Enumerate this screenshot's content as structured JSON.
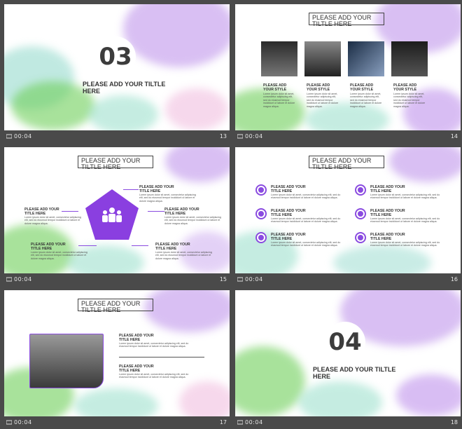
{
  "slides": [
    {
      "number": "13",
      "time": "00:04",
      "big": "03",
      "title": "PLEASE ADD YOUR TILTLE HERE"
    },
    {
      "number": "14",
      "time": "00:04",
      "title": "PLEASE ADD YOUR TILTLE HERE",
      "item_label": "PLEASE ADD YOUR STYLE",
      "item_text": "Lorem ipsum dolor sit amet, consectetur adipiscing elit, sed do eiusmod tempor incididunt ut labore et dolore magna aliqua."
    },
    {
      "number": "15",
      "time": "00:04",
      "title": "PLEASE ADD YOUR TILTLE HERE",
      "label": "PLEASE ADD YOUR TITLE HERE",
      "text": "Lorem ipsum dolor sit amet, consectetur adipiscing elit, sed do eiusmod tempor incididunt ut labore et dolore magna aliqua."
    },
    {
      "number": "16",
      "time": "00:04",
      "title": "PLEASE ADD YOUR TILTLE HERE",
      "label": "PLEASE ADD YOUR TITLE HERE",
      "text": "Lorem ipsum dolor sit amet, consectetur adipiscing elit, sed do eiusmod tempor incididunt ut labore et dolore magna aliqua."
    },
    {
      "number": "17",
      "time": "00:04",
      "title": "PLEASE ADD YOUR TILTLE HERE",
      "label": "PLEASE ADD YOUR TITLE HERE",
      "text": "Lorem ipsum dolor sit amet, consectetur adipiscing elit, sed do eiusmod tempor incididunt ut labore et dolore magna aliqua."
    },
    {
      "number": "18",
      "time": "00:04",
      "big": "04",
      "title": "PLEASE ADD YOUR TILTLE HERE"
    }
  ],
  "colors": {
    "accent": "#8a4be0",
    "bar": "#4a4a4a"
  }
}
